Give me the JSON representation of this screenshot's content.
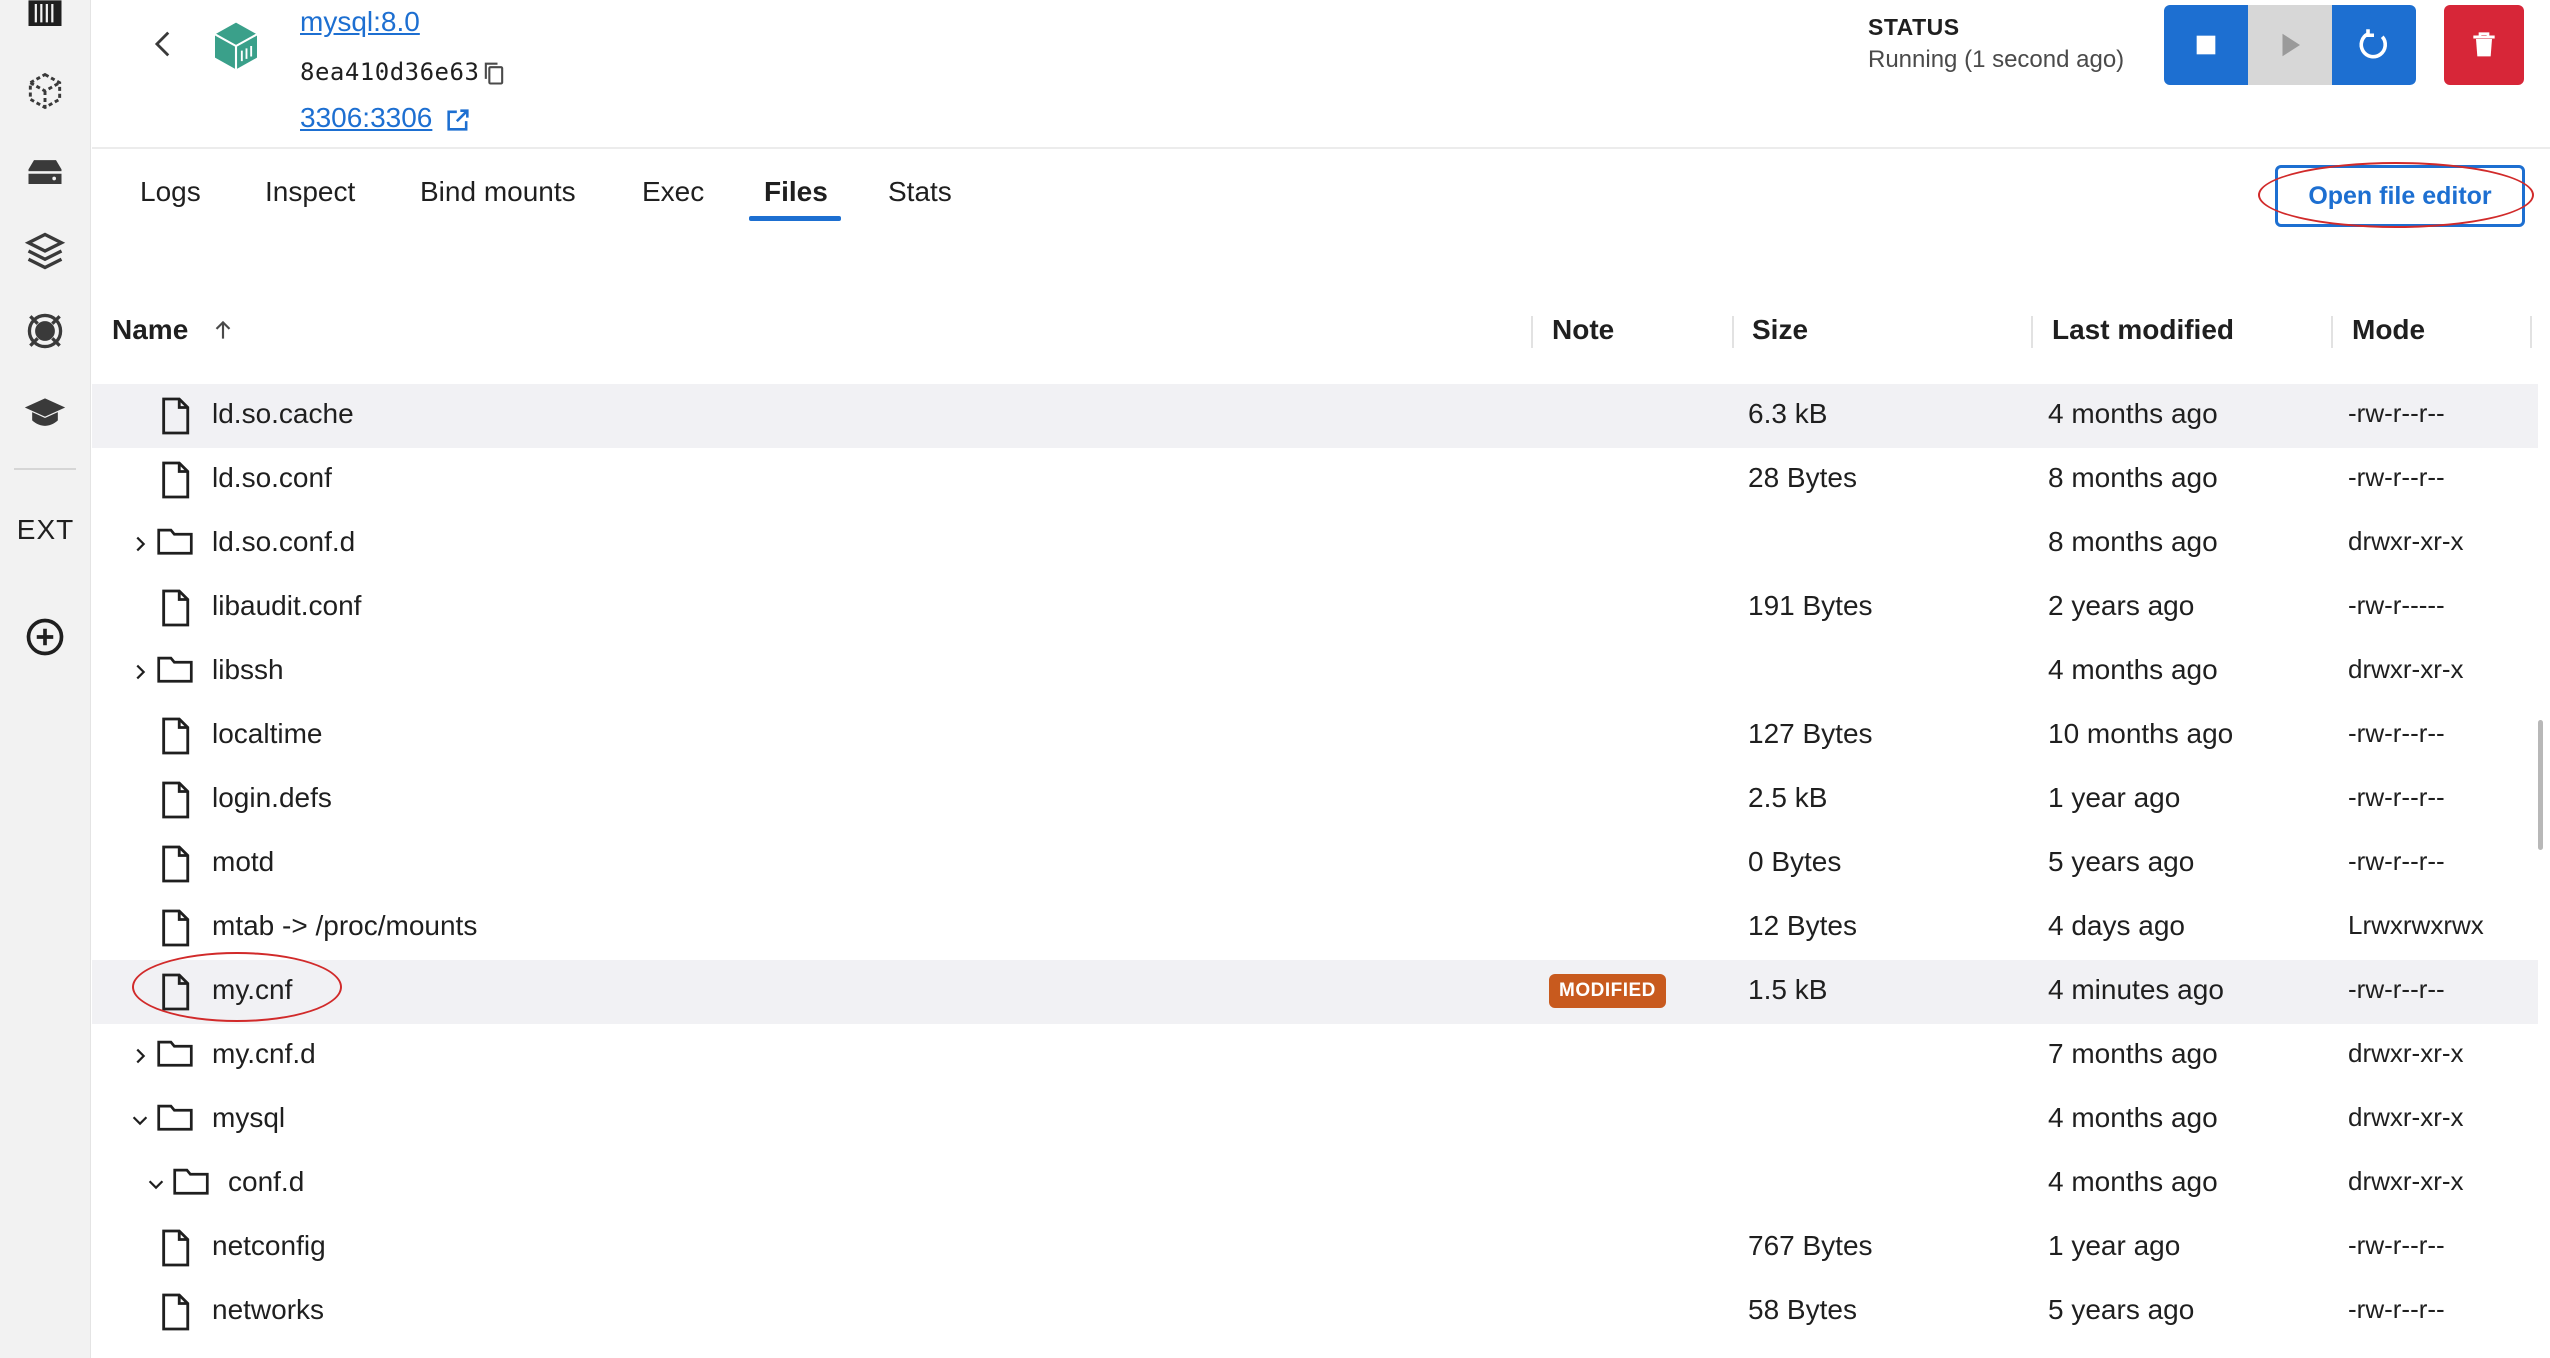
{
  "header": {
    "title": "mysql:8.0",
    "container_id": "8ea410d36e63",
    "port": "3306:3306",
    "status_label": "STATUS",
    "status_value": "Running (1 second ago)"
  },
  "sidebar": {
    "items": [
      {
        "icon": "containers-icon"
      },
      {
        "icon": "images-icon"
      },
      {
        "icon": "volumes-icon"
      },
      {
        "icon": "builds-icon"
      },
      {
        "icon": "scout-icon"
      },
      {
        "icon": "learning-center-icon"
      }
    ],
    "ext_label": "EXT",
    "add_extension_icon": "plus-circle-icon"
  },
  "tabs": [
    {
      "label": "Logs"
    },
    {
      "label": "Inspect"
    },
    {
      "label": "Bind mounts"
    },
    {
      "label": "Exec"
    },
    {
      "label": "Files",
      "active": true
    },
    {
      "label": "Stats"
    }
  ],
  "open_editor_label": "Open file editor",
  "table": {
    "columns": {
      "name": "Name",
      "note": "Note",
      "size": "Size",
      "last_modified": "Last modified",
      "mode": "Mode"
    },
    "rows": [
      {
        "name": "ld.so.cache",
        "type": "file",
        "size": "6.3 kB",
        "modified": "4 months ago",
        "mode": "-rw-r--r--"
      },
      {
        "name": "ld.so.conf",
        "type": "file",
        "size": "28 Bytes",
        "modified": "8 months ago",
        "mode": "-rw-r--r--"
      },
      {
        "name": "ld.so.conf.d",
        "type": "folder",
        "size": "",
        "modified": "8 months ago",
        "mode": "drwxr-xr-x"
      },
      {
        "name": "libaudit.conf",
        "type": "file",
        "size": "191 Bytes",
        "modified": "2 years ago",
        "mode": "-rw-r-----"
      },
      {
        "name": "libssh",
        "type": "folder",
        "size": "",
        "modified": "4 months ago",
        "mode": "drwxr-xr-x"
      },
      {
        "name": "localtime",
        "type": "file",
        "size": "127 Bytes",
        "modified": "10 months ago",
        "mode": "-rw-r--r--"
      },
      {
        "name": "login.defs",
        "type": "file",
        "size": "2.5 kB",
        "modified": "1 year ago",
        "mode": "-rw-r--r--"
      },
      {
        "name": "motd",
        "type": "file",
        "size": "0 Bytes",
        "modified": "5 years ago",
        "mode": "-rw-r--r--"
      },
      {
        "name": "mtab -> /proc/mounts",
        "type": "file",
        "size": "12 Bytes",
        "modified": "4 days ago",
        "mode": "Lrwxrwxrwx"
      },
      {
        "name": "my.cnf",
        "type": "file",
        "note": "MODIFIED",
        "size": "1.5 kB",
        "modified": "4 minutes ago",
        "mode": "-rw-r--r--"
      },
      {
        "name": "my.cnf.d",
        "type": "folder",
        "size": "",
        "modified": "7 months ago",
        "mode": "drwxr-xr-x"
      },
      {
        "name": "mysql",
        "type": "folder-open",
        "size": "",
        "modified": "4 months ago",
        "mode": "drwxr-xr-x"
      },
      {
        "name": "conf.d",
        "type": "folder-open",
        "size": "",
        "modified": "4 months ago",
        "mode": "drwxr-xr-x"
      },
      {
        "name": "netconfig",
        "type": "file",
        "size": "767 Bytes",
        "modified": "1 year ago",
        "mode": "-rw-r--r--"
      },
      {
        "name": "networks",
        "type": "file",
        "size": "58 Bytes",
        "modified": "5 years ago",
        "mode": "-rw-r--r--"
      }
    ]
  },
  "colors": {
    "accent": "#1d6fd1",
    "danger": "#d72638",
    "badge": "#c85a1e",
    "annotation": "#d12a2a",
    "container_icon": "#3aa08a"
  }
}
